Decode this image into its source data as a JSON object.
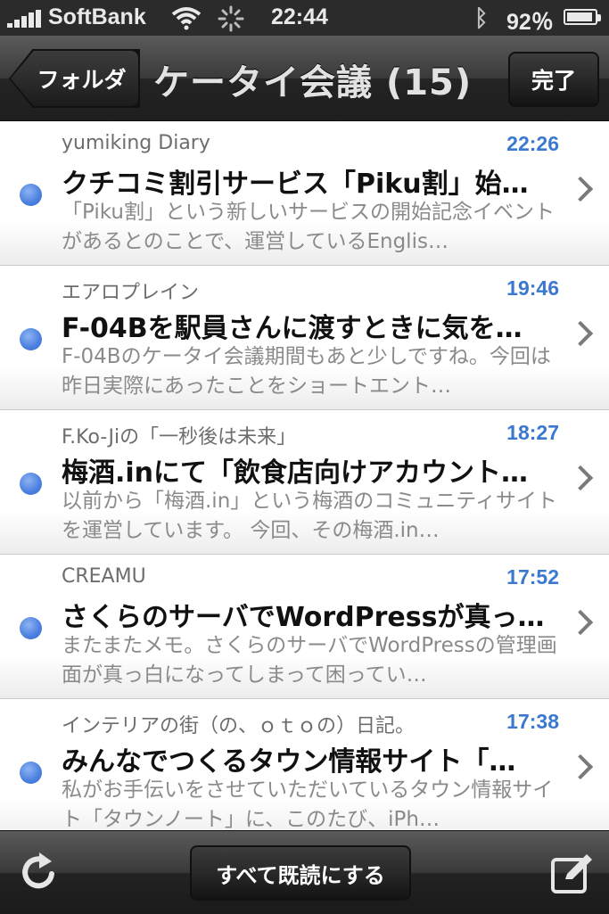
{
  "status_bar": {
    "carrier": "SoftBank",
    "time": "22:44",
    "battery_text": "92％",
    "battery_level": 0.92
  },
  "nav": {
    "back_label": "フォルダ",
    "title": "ケータイ会議 (15)",
    "done_label": "完了"
  },
  "items": [
    {
      "source": "yumiking Diary",
      "time": "22:26",
      "title": "クチコミ割引サービス「Piku割」始…",
      "body": "「Piku割」という新しいサービスの開始記念イベントがあるとのことで、運営しているEnglis…"
    },
    {
      "source": "エアロプレイン",
      "time": "19:46",
      "title": "F-04Bを駅員さんに渡すときに気を…",
      "body": "F-04Bのケータイ会議期間もあと少しですね。今回は昨日実際にあったことをショートエント…"
    },
    {
      "source": "F.Ko-Jiの「一秒後は未来」",
      "time": "18:27",
      "title": "梅酒.inにて「飲食店向けアカウント…",
      "body": "以前から「梅酒.in」という梅酒のコミュニティサイトを運営しています。 今回、その梅酒.in…"
    },
    {
      "source": "CREAMU",
      "time": "17:52",
      "title": "さくらのサーバでWordPressが真っ…",
      "body": "またまたメモ。さくらのサーバでWordPressの管理画面が真っ白になってしまって困ってい…"
    },
    {
      "source": "インテリアの街（の、ｏｔｏの）日記。",
      "time": "17:38",
      "title": "みんなでつくるタウン情報サイト「…",
      "body": "私がお手伝いをさせていただいているタウン情報サイト「タウンノート」に、このたび、iPh…"
    }
  ],
  "toolbar": {
    "mark_all_label": "すべて既読にする"
  },
  "colors": {
    "unread_dot": "#4a7fe0",
    "time_text": "#3b78d0"
  },
  "icons": {
    "refresh": "refresh-icon",
    "compose": "compose-icon",
    "chevron": "chevron-right-icon",
    "wifi": "wifi-icon",
    "bluetooth": "bluetooth-icon"
  }
}
